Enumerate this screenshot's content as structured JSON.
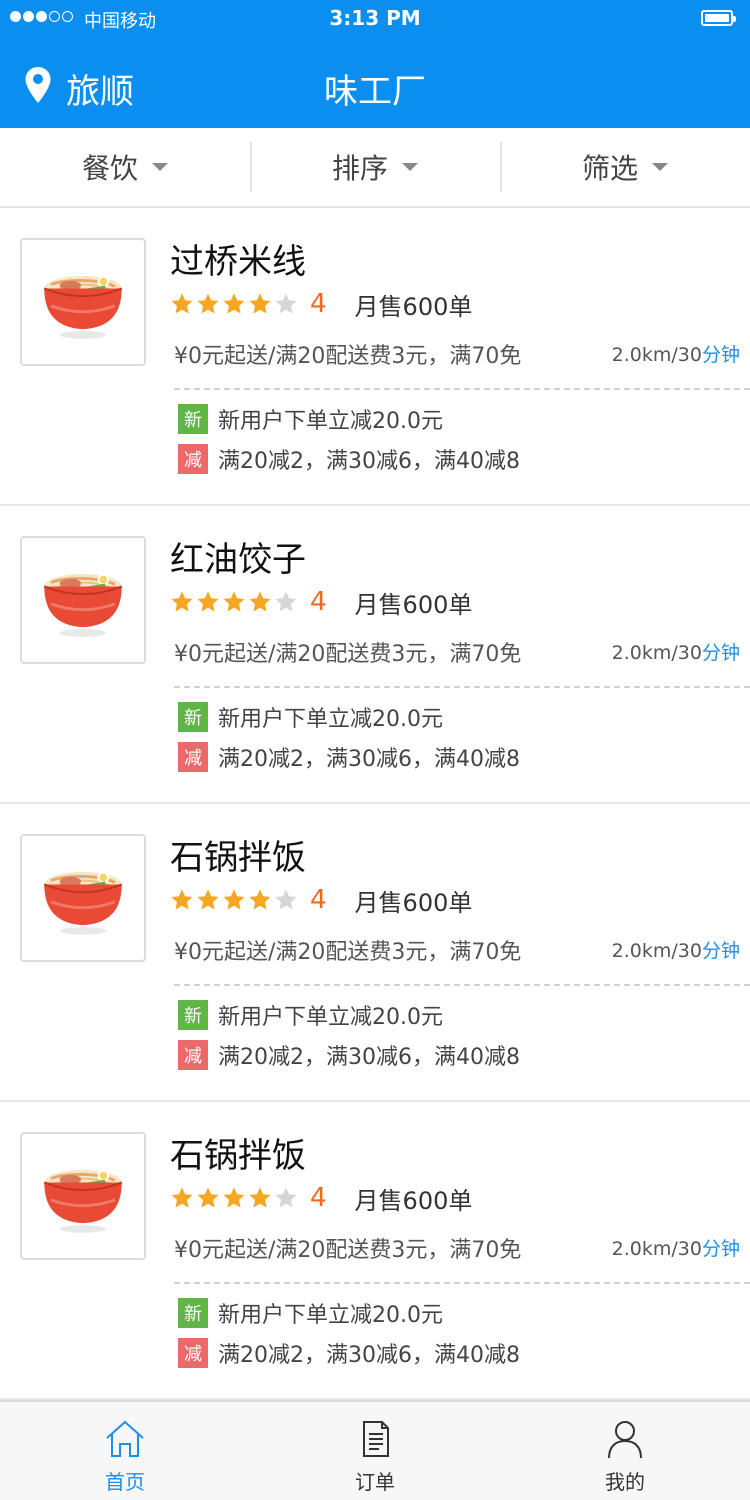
{
  "status_bar": {
    "carrier": "中国移动",
    "time": "3:13 PM"
  },
  "header": {
    "location": "旅顺",
    "title": "味工厂"
  },
  "filters": [
    {
      "label": "餐饮"
    },
    {
      "label": "排序"
    },
    {
      "label": "筛选"
    }
  ],
  "colors": {
    "brand_blue": "#0a8ff0",
    "star_active": "#f5a623",
    "star_inactive": "#d6d6d6",
    "score": "#f06a1e",
    "new_badge": "#5fb645",
    "discount_badge": "#ea6a6a"
  },
  "shops": [
    {
      "name": "过桥米线",
      "rating": 4,
      "score": "4",
      "sales": "月售600单",
      "delivery": "¥0元起送/满20配送费3元，满70免",
      "distance": "2.0km/30",
      "time_unit": "分钟",
      "promo_new_badge": "新",
      "promo_new": "新用户下单立减20.0元",
      "promo_discount_badge": "减",
      "promo_discount": "满20减2，满30减6，满40减8"
    },
    {
      "name": "红油饺子",
      "rating": 4,
      "score": "4",
      "sales": "月售600单",
      "delivery": "¥0元起送/满20配送费3元，满70免",
      "distance": "2.0km/30",
      "time_unit": "分钟",
      "promo_new_badge": "新",
      "promo_new": "新用户下单立减20.0元",
      "promo_discount_badge": "减",
      "promo_discount": "满20减2，满30减6，满40减8"
    },
    {
      "name": "石锅拌饭",
      "rating": 4,
      "score": "4",
      "sales": "月售600单",
      "delivery": "¥0元起送/满20配送费3元，满70免",
      "distance": "2.0km/30",
      "time_unit": "分钟",
      "promo_new_badge": "新",
      "promo_new": "新用户下单立减20.0元",
      "promo_discount_badge": "减",
      "promo_discount": "满20减2，满30减6，满40减8"
    },
    {
      "name": "石锅拌饭",
      "rating": 4,
      "score": "4",
      "sales": "月售600单",
      "delivery": "¥0元起送/满20配送费3元，满70免",
      "distance": "2.0km/30",
      "time_unit": "分钟",
      "promo_new_badge": "新",
      "promo_new": "新用户下单立减20.0元",
      "promo_discount_badge": "减",
      "promo_discount": "满20减2，满30减6，满40减8"
    }
  ],
  "tabs": [
    {
      "label": "首页",
      "icon": "home-icon",
      "active": true
    },
    {
      "label": "订单",
      "icon": "order-icon",
      "active": false
    },
    {
      "label": "我的",
      "icon": "user-icon",
      "active": false
    }
  ]
}
